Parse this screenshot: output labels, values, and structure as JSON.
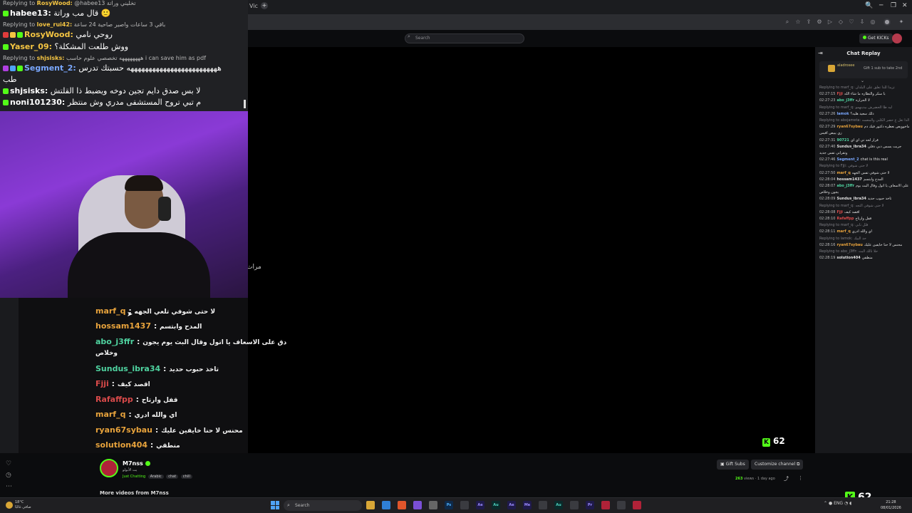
{
  "browser": {
    "tab_label": "Vic",
    "new_tab": "+",
    "window_controls": [
      "🔍",
      "─",
      "❐",
      "✕"
    ]
  },
  "kick": {
    "search_placeholder": "Search",
    "get_kicks": "Get KICKs"
  },
  "overlay_chat": {
    "lines": [
      {
        "type": "reply",
        "text": "Replying to",
        "name": "RosyWood:",
        "msg": "@habee13 تخليني وراتة"
      },
      {
        "type": "msg",
        "name": "habee13:",
        "color": "#ffffff",
        "msg": "قال مب وراتة 🙂"
      },
      {
        "type": "reply",
        "text": "Replying to",
        "name": "love_rui42:",
        "msg": "باقي 3 ساعات واصير صاحية 24 ساعة"
      },
      {
        "type": "msg",
        "name": "RosyWood:",
        "color": "#f5c542",
        "msg": "روحي نامي"
      },
      {
        "type": "msg",
        "name": "Yaser_09:",
        "color": "#f5c542",
        "msg": "ووش طلعت المشكلة؟"
      },
      {
        "type": "reply",
        "text": "Replying to",
        "name": "shjsisks:",
        "msg": "ههههههههه تخصصي علوم حاسب i can save him as pdf"
      },
      {
        "type": "msg",
        "name": "Segment_2:",
        "color": "#7aa8ff",
        "msg": "هههههههههههههههههههههههههه حسبتك تدرس"
      },
      {
        "type": "cont",
        "msg": "طب"
      },
      {
        "type": "msg",
        "name": "shjsisks:",
        "color": "#ffffff",
        "msg": "لا بس صدق دايم تجين دوخه ويضبط ذا القلتش"
      },
      {
        "type": "msg",
        "name": "noni101230:",
        "color": "#ffffff",
        "msg": "م تبي تروح المستشفى مدري وش منتظر"
      }
    ]
  },
  "side_caption": "مرات",
  "lower_chat": {
    "lines": [
      {
        "name": "marf_q",
        "color": "#e8a33c",
        "msg": "لا حتى شوفي تلعي الجهه"
      },
      {
        "name": "hossam1437",
        "color": "#e8a33c",
        "msg": "المدح وابتسم"
      },
      {
        "name": "abo_j3ffr",
        "color": "#4fd3a0",
        "msg": "دق على الاسعاف يا اتول وقال البث يوم يجون"
      },
      {
        "cont": true,
        "msg": "وخلاص"
      },
      {
        "name": "Sundus_ibra34",
        "color": "#4fd3a0",
        "msg": "تاخذ حبوب حديد"
      },
      {
        "name": "Fjji",
        "color": "#d94a4a",
        "msg": "اقصد كيف"
      },
      {
        "name": "Rafaffpp",
        "color": "#d94a4a",
        "msg": "قفل وارتاح"
      },
      {
        "name": "marf_q",
        "color": "#e8a33c",
        "msg": "اي والله ادري"
      },
      {
        "name": "ryan67sybau",
        "color": "#e8a33c",
        "msg": "محنس لا حنا خايفين عليك"
      },
      {
        "name": "solution404",
        "color": "#e8a33c",
        "msg": "منطقي"
      }
    ]
  },
  "viewer_count": "62",
  "chat_replay": {
    "title": "Chat Replay",
    "pinned_name": "aladrosee",
    "pinned_text": "Gift 1 sub to take 2nd",
    "lines": [
      {
        "type": "reply",
        "msg": "Replying to marf_q: تزيدا للذا تعلق على البلدان"
      },
      {
        "ts": "02:27:15",
        "name": "Fjji",
        "color": "#d94a4a",
        "msg": "با سكر والتظاره ما شاء الله"
      },
      {
        "ts": "02:27:23",
        "name": "abo_j3ffr",
        "color": "#4fd3a0",
        "msg": "لا الحراره"
      },
      {
        "type": "reply",
        "msg": "Replying to marf_q: ليه ظا الحضرش بيدينهمو"
      },
      {
        "ts": "02:27:26",
        "name": "lamok",
        "color": "#7aa8ff",
        "msg": "ذلك سعيد هليه؟"
      },
      {
        "type": "reply",
        "msg": "Replying to abojameta: قعد الذا تعل ع حصر الكلبي والمعسه"
      },
      {
        "ts": "02:27:29",
        "name": "ryan67sybau",
        "color": "#e8a33c",
        "msg": "هلا ماخوويص نعطره دكتور فيك دم"
      },
      {
        "type": "cont",
        "msg": "زي يبيص اقيس"
      },
      {
        "ts": "02:27:31",
        "name": "90721",
        "color": "#4fd3a0",
        "msg": "قرار لحد تي اي اي"
      },
      {
        "ts": "02:27:40",
        "name": "Sundus_ibra34",
        "color": "#e0e0e0",
        "msg": "جربت يسس دبي دفلي"
      },
      {
        "type": "cont",
        "msg": "وتقرأني تفس جديد"
      },
      {
        "ts": "02:27:46",
        "name": "Segment_2",
        "color": "#7aa8ff",
        "msg": "chat is this real"
      },
      {
        "type": "reply",
        "msg": "Replying to Fjji: لا حتى شوفي"
      },
      {
        "ts": "02:27:50",
        "name": "marf_q",
        "color": "#e8a33c",
        "msg": "لا حتى شوفي تفس الجهه"
      },
      {
        "ts": "02:28:04",
        "name": "hossam1437",
        "color": "#e0e0e0",
        "msg": "المدح وابتسم"
      },
      {
        "ts": "02:28:07",
        "name": "abo_j3ffr",
        "color": "#4fd3a0",
        "msg": "دق على الاسعاف يا اتول وقال البث يوم"
      },
      {
        "type": "cont",
        "msg": "يجون وخلاص"
      },
      {
        "ts": "02:28:09",
        "name": "Sundus_ibra34",
        "color": "#e0e0e0",
        "msg": "تاخذ حبوب حديد"
      },
      {
        "type": "reply",
        "msg": "Replying to marf_q: لا حتى شوفي التجه"
      },
      {
        "ts": "02:28:08",
        "name": "Fjji",
        "color": "#d94a4a",
        "msg": "اقصد كيف"
      },
      {
        "ts": "02:28:10",
        "name": "Rafaffpp",
        "color": "#d94a4a",
        "msg": "قفل وارتاح"
      },
      {
        "type": "reply",
        "msg": "Replying to marf_q: قلل تابي"
      },
      {
        "ts": "02:28:11",
        "name": "marf_q",
        "color": "#e8a33c",
        "msg": "اي والله ادري"
      },
      {
        "type": "reply",
        "msg": "Replying to lamok: حد البيك"
      },
      {
        "ts": "02:28:16",
        "name": "ryan67sybau",
        "color": "#e8a33c",
        "msg": "محنس لا حنا خايفين عليك"
      },
      {
        "type": "reply",
        "msg": "Replying to abo_j3ffr: حلا تالك البث"
      },
      {
        "ts": "02:28:19",
        "name": "solution404",
        "color": "#e0e0e0",
        "msg": "منطقي"
      }
    ]
  },
  "channel": {
    "name": "M7nss",
    "subtitle": "يت الأبولو",
    "category": "Just Chatting",
    "tags": [
      "Arabic",
      "chat",
      "chill"
    ],
    "gift_subs": "Gift Subs",
    "customize": "Customize channel",
    "views_count": "263",
    "views_label": "views",
    "age": "1 day ago",
    "more_videos": "More videos from M7nss"
  },
  "taskbar": {
    "temp": "18°C",
    "weather": "صافي غالبًا",
    "search": "Search",
    "lang": "ENG",
    "time": "21:28",
    "date": "08/01/2026",
    "apps": [
      "Ps",
      "Ae",
      "Au",
      "Ae",
      "Me",
      "Au",
      "Pr"
    ],
    "overlay_count": "62"
  }
}
